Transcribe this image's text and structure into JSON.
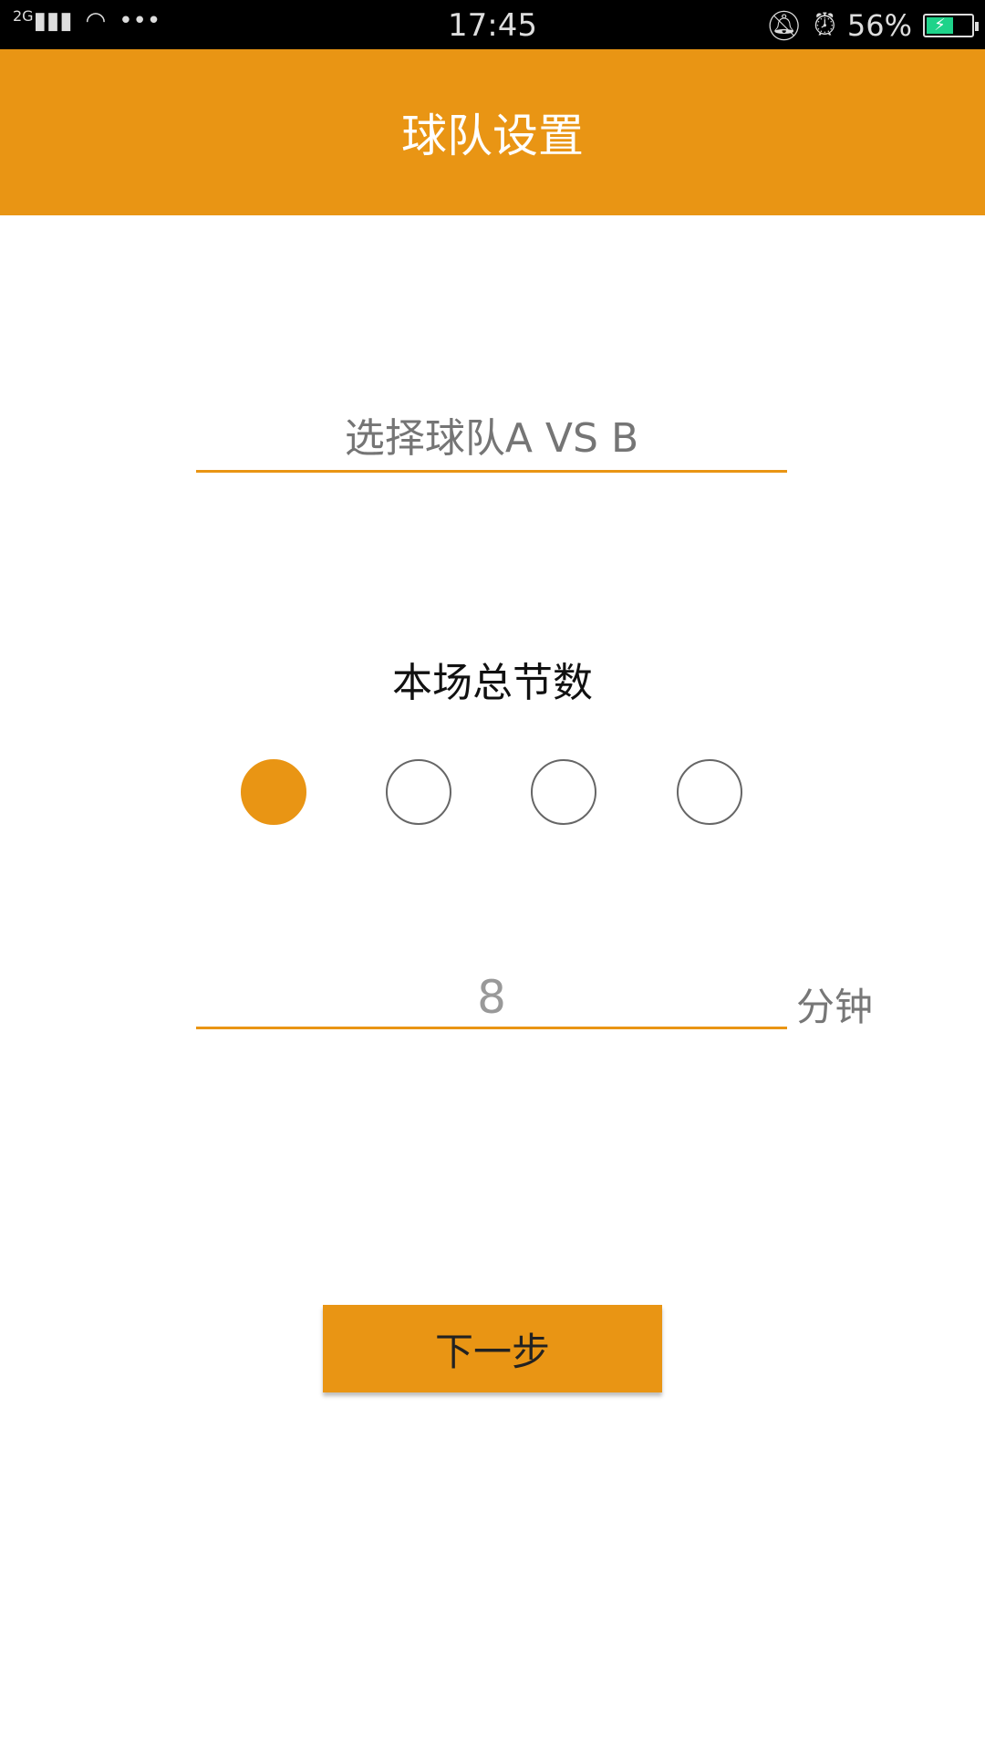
{
  "status_bar": {
    "network": "2G",
    "time": "17:45",
    "battery": "56%",
    "icons": [
      "signal-icon",
      "wifi-icon",
      "more-icon",
      "bell-off-icon",
      "alarm-icon",
      "battery-charging-icon"
    ]
  },
  "app_bar": {
    "title": "球队设置"
  },
  "team_field": {
    "placeholder": "选择球队A VS B"
  },
  "periods": {
    "label": "本场总节数",
    "options_count": 4,
    "selected_index": 0
  },
  "minutes_field": {
    "value": "8",
    "unit": "分钟"
  },
  "next_button": {
    "label": "下一步"
  },
  "colors": {
    "accent": "#e99514",
    "status_bar": "#000000"
  }
}
